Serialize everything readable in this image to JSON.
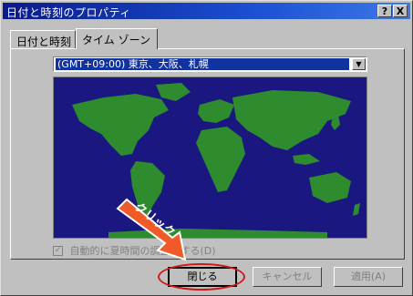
{
  "window": {
    "title": "日付と時刻のプロパティ",
    "help_button": "?",
    "close_button": "X"
  },
  "tabs": [
    {
      "label": "日付と時刻"
    },
    {
      "label": "タイム ゾーン"
    }
  ],
  "timezone": {
    "selected": "(GMT+09:00) 東京、大阪、札幌"
  },
  "checkbox": {
    "label": "自動的に夏時間の調整をする(D)",
    "checked": true
  },
  "buttons": {
    "ok": "閉じる",
    "cancel": "キャンセル",
    "apply": "適用(A)"
  },
  "annotation": {
    "click_label": "クリック",
    "highlight_color": "#d01818",
    "arrow_color": "#f05a28"
  },
  "colors": {
    "titlebar": "#0a1a8a",
    "map_ocean": "#1a1780",
    "map_land": "#2e8b2e"
  }
}
